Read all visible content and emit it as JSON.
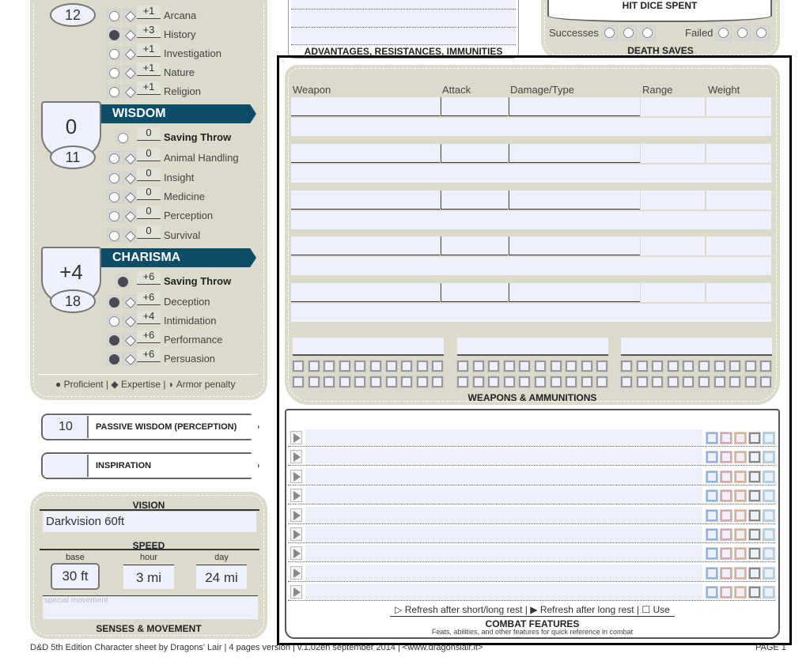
{
  "colors": {
    "panel": "#dcdacb",
    "banner": "#0d4d68",
    "field": "#eef0fc"
  },
  "intelligence": {
    "score": "12",
    "skills": [
      {
        "prof": false,
        "value": "+1",
        "label": "Arcana"
      },
      {
        "prof": true,
        "value": "+3",
        "label": "History"
      },
      {
        "prof": false,
        "value": "+1",
        "label": "Investigation"
      },
      {
        "prof": false,
        "value": "+1",
        "label": "Nature"
      },
      {
        "prof": false,
        "value": "+1",
        "label": "Religion"
      }
    ]
  },
  "wisdom": {
    "title": "WISDOM",
    "modifier": "0",
    "score": "11",
    "saving_throw": {
      "prof": false,
      "value": "0",
      "label": "Saving Throw"
    },
    "skills": [
      {
        "prof": false,
        "value": "0",
        "label": "Animal Handling"
      },
      {
        "prof": false,
        "value": "0",
        "label": "Insight"
      },
      {
        "prof": false,
        "value": "0",
        "label": "Medicine"
      },
      {
        "prof": false,
        "value": "0",
        "label": "Perception"
      },
      {
        "prof": false,
        "value": "0",
        "label": "Survival"
      }
    ]
  },
  "charisma": {
    "title": "CHARISMA",
    "modifier": "+4",
    "score": "18",
    "saving_throw": {
      "prof": true,
      "value": "+6",
      "label": "Saving Throw"
    },
    "skills": [
      {
        "prof": true,
        "value": "+6",
        "label": "Deception"
      },
      {
        "prof": false,
        "value": "+4",
        "label": "Intimidation"
      },
      {
        "prof": true,
        "value": "+6",
        "label": "Performance"
      },
      {
        "prof": true,
        "value": "+6",
        "label": "Persuasion"
      }
    ]
  },
  "legend": {
    "proficient": "Proficient",
    "expertise": "Expertise",
    "armor": "Armor penalty"
  },
  "passive_wisdom": {
    "value": "10",
    "label": "PASSIVE WISDOM (PERCEPTION)"
  },
  "inspiration": {
    "value": "",
    "label": "INSPIRATION"
  },
  "senses": {
    "vision_title": "VISION",
    "vision": "Darkvision 60ft",
    "speed_title": "SPEED",
    "base_label": "base",
    "base": "30 ft",
    "hour_label": "hour",
    "hour": "3 mi",
    "day_label": "day",
    "day": "24 mi",
    "special_placeholder": "special movement",
    "title": "SENSES & MOVEMENT"
  },
  "advantages": {
    "title": "ADVANTAGES, RESISTANCES, IMMUNITIES"
  },
  "death_saves": {
    "hit_dice_title": "HIT DICE SPENT",
    "successes": "Successes",
    "failed": "Failed",
    "title": "DEATH SAVES"
  },
  "weapons": {
    "headers": [
      "Weapon",
      "Attack",
      "Damage/Type",
      "Range",
      "Weight"
    ],
    "row_count": 5,
    "title": "WEAPONS & AMMUNITIONS"
  },
  "combat": {
    "row_count": 9,
    "legend_short": "Refresh after short/long rest |",
    "legend_long": "Refresh after long rest |",
    "legend_use": "Use",
    "title": "COMBAT FEATURES",
    "subtitle": "Feats, abilities, and other features for quick reference in combat"
  },
  "footer": {
    "credit": "D&D 5th Edition Character sheet by Dragons' Lair | 4 pages version | v.1.02en september 2014 | <www.dragonslair.it>",
    "page": "PAGE 1"
  }
}
